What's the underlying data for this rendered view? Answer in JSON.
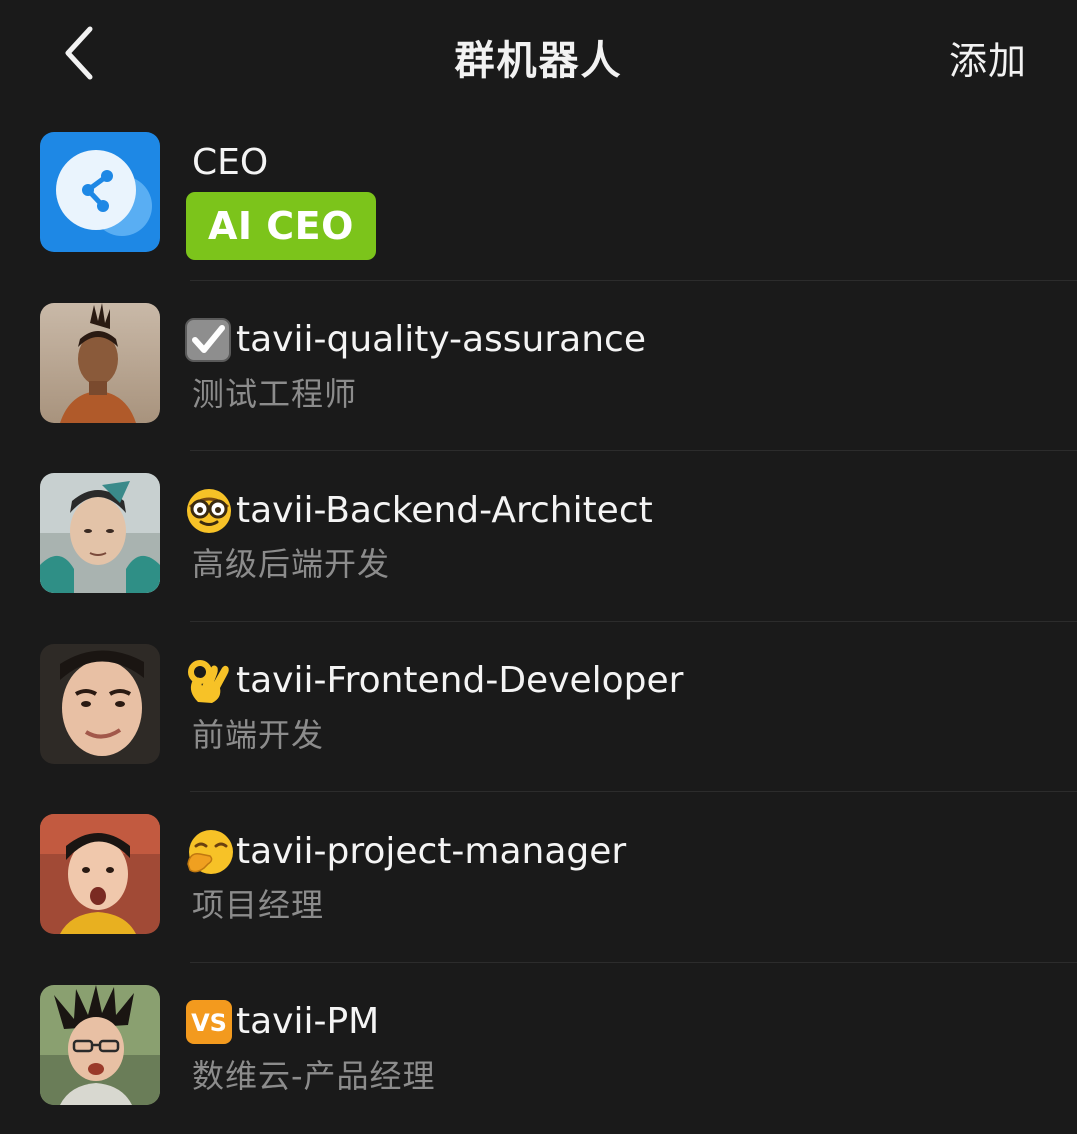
{
  "nav": {
    "back_icon": "chevron-left-icon",
    "title": "群机器人",
    "add_label": "添加"
  },
  "bots": [
    {
      "name": "CEO",
      "badge": "AI CEO",
      "badge_color": "#7cc41b",
      "avatar": "app-logo-icon",
      "avatar_color": "#1e88e5"
    },
    {
      "emoji": "checkbox-icon",
      "name": "tavii-quality-assurance",
      "role": "测试工程师",
      "avatar": "person-photo"
    },
    {
      "emoji": "nerd-face-icon",
      "name": "tavii-Backend-Architect",
      "role": "高级后端开发",
      "avatar": "person-photo"
    },
    {
      "emoji": "ok-hand-icon",
      "name": "tavii-Frontend-Developer",
      "role": "前端开发",
      "avatar": "person-photo"
    },
    {
      "emoji": "yawning-face-icon",
      "name": "tavii-project-manager",
      "role": "项目经理",
      "avatar": "person-photo"
    },
    {
      "emoji": "vs-button-icon",
      "emoji_text": "VS",
      "name": "tavii-PM",
      "role": "数维云-产品经理",
      "avatar": "person-photo"
    }
  ]
}
